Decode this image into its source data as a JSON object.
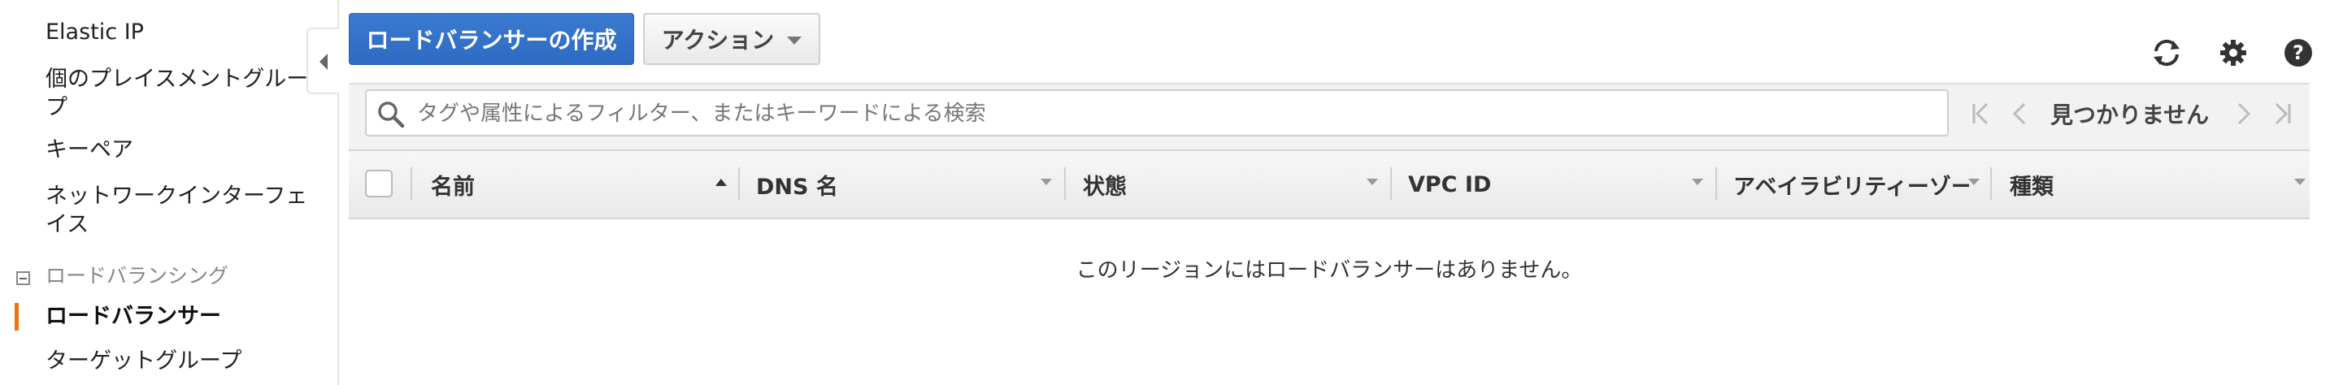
{
  "sidebar": {
    "items_top": [
      "Elastic IP",
      "個のプレイスメントグループ",
      "キーペア",
      "ネットワークインターフェイス"
    ],
    "section_label": "ロードバランシング",
    "active_item": "ロードバランサー",
    "next_item": "ターゲットグループ"
  },
  "toolbar": {
    "create_label": "ロードバランサーの作成",
    "action_label": "アクション",
    "icons": [
      "refresh-icon",
      "gear-icon",
      "help-icon"
    ]
  },
  "search": {
    "placeholder": "タグや属性によるフィルター、またはキーワードによる検索",
    "value": ""
  },
  "pager": {
    "status": "見つかりません"
  },
  "table": {
    "columns": [
      "名前",
      "DNS 名",
      "状態",
      "VPC ID",
      "アベイラビリティーゾー",
      "種類"
    ],
    "empty_message": "このリージョンにはロードバランサーはありません。"
  },
  "colors": {
    "primary": "#2e6bc4",
    "accent": "#ec7211"
  }
}
